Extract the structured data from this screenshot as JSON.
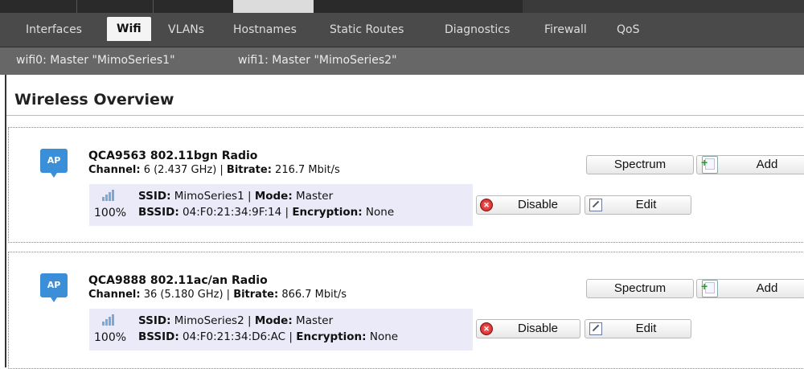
{
  "tabs": [
    {
      "label": "Interfaces",
      "active": false
    },
    {
      "label": "Wifi",
      "active": true
    },
    {
      "label": "VLANs",
      "active": false
    },
    {
      "label": "Hostnames",
      "active": false
    },
    {
      "label": "Static Routes",
      "active": false
    },
    {
      "label": "Diagnostics",
      "active": false
    },
    {
      "label": "Firewall",
      "active": false
    },
    {
      "label": "QoS",
      "active": false
    }
  ],
  "subtabs": [
    {
      "label": "wifi0: Master \"MimoSeries1\""
    },
    {
      "label": "wifi1: Master \"MimoSeries2\""
    }
  ],
  "page_title": "Wireless Overview",
  "radios": [
    {
      "badge": "AP",
      "name": "QCA9563 802.11bgn Radio",
      "channel_label": "Channel:",
      "channel_value": " 6 (2.437 GHz) | ",
      "bitrate_label": "Bitrate:",
      "bitrate_value": " 216.7 Mbit/s",
      "spectrum_label": "Spectrum",
      "add_label": "Add",
      "network": {
        "signal_pct": "100%",
        "ssid_label": "SSID:",
        "ssid_value": " MimoSeries1 | ",
        "mode_label": "Mode:",
        "mode_value": " Master",
        "bssid_label": "BSSID:",
        "bssid_value": " 04:F0:21:34:9F:14 | ",
        "enc_label": "Encryption:",
        "enc_value": " None",
        "disable_label": "Disable",
        "edit_label": "Edit"
      }
    },
    {
      "badge": "AP",
      "name": "QCA9888 802.11ac/an Radio",
      "channel_label": "Channel:",
      "channel_value": " 36 (5.180 GHz) | ",
      "bitrate_label": "Bitrate:",
      "bitrate_value": " 866.7 Mbit/s",
      "spectrum_label": "Spectrum",
      "add_label": "Add",
      "network": {
        "signal_pct": "100%",
        "ssid_label": "SSID:",
        "ssid_value": " MimoSeries2 | ",
        "mode_label": "Mode:",
        "mode_value": " Master",
        "bssid_label": "BSSID:",
        "bssid_value": " 04:F0:21:34:D6:AC | ",
        "enc_label": "Encryption:",
        "enc_value": " None",
        "disable_label": "Disable",
        "edit_label": "Edit"
      }
    }
  ],
  "colors": {
    "tabbar_bg": "#4a4a4a",
    "subbar_bg": "#676767",
    "ap_badge": "#3b8fd8",
    "ssid_row_bg": "#eaeaf8"
  }
}
